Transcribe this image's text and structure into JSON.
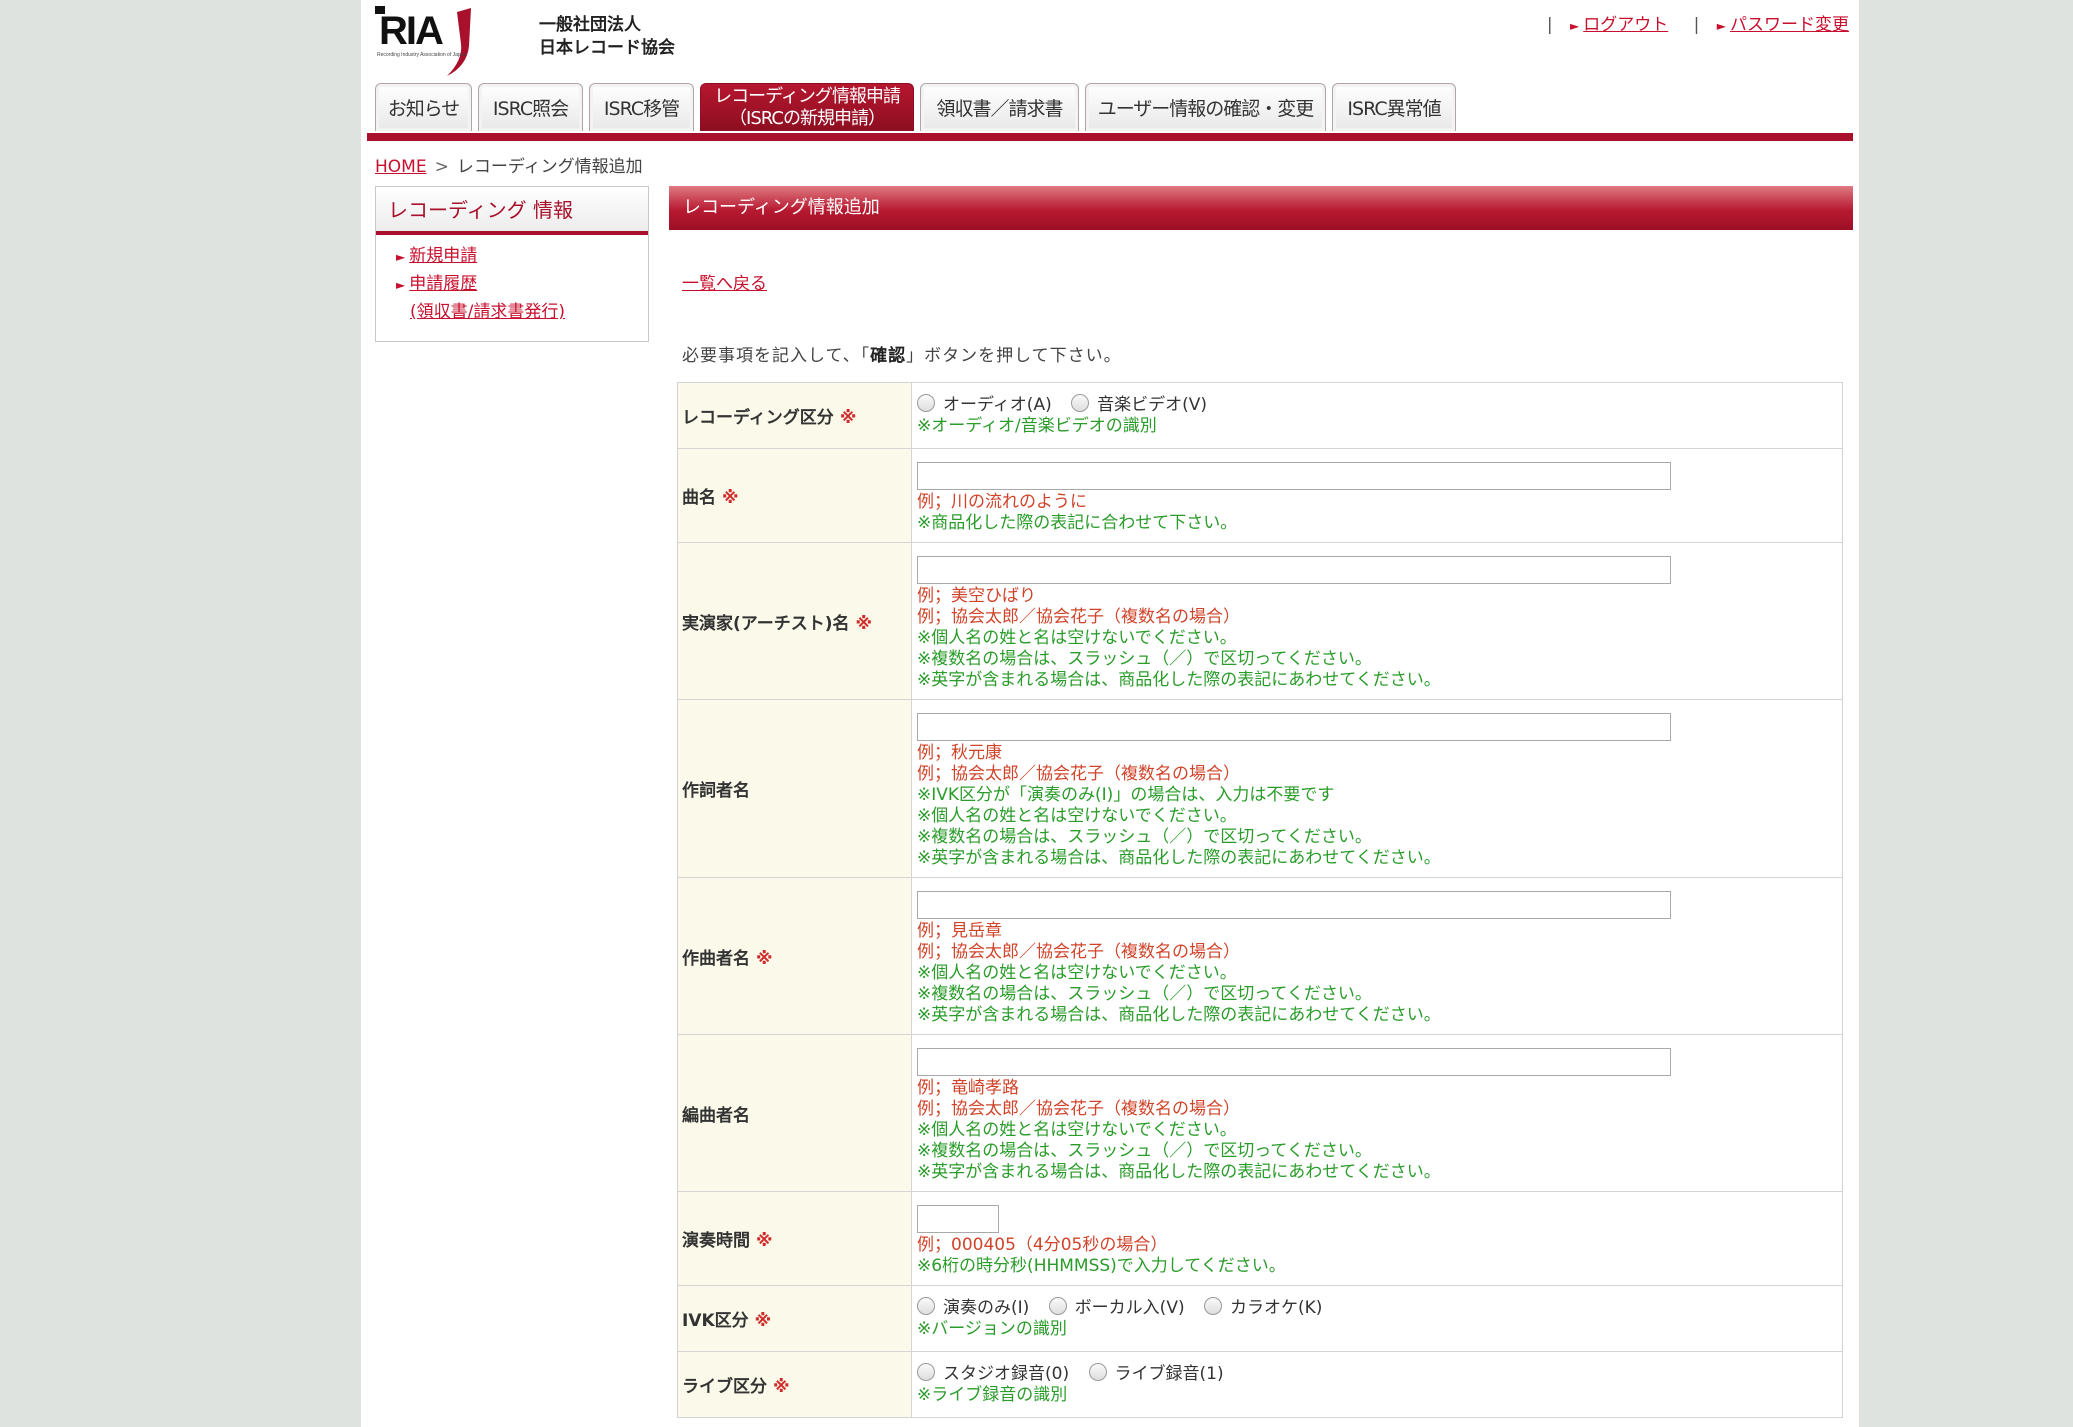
{
  "header": {
    "logo_text": "RIAJ",
    "logo_subtext": "Recording Industry Association of Japan",
    "org_line1": "一般社団法人",
    "org_line2": "日本レコード協会",
    "links": [
      {
        "label": "ログアウト"
      },
      {
        "label": "パスワード変更"
      }
    ]
  },
  "tabs": [
    {
      "label": "お知らせ"
    },
    {
      "label": "ISRC照会"
    },
    {
      "label": "ISRC移管"
    },
    {
      "label_line1": "レコーディング情報申請",
      "label_line2": "（ISRCの新規申請）"
    },
    {
      "label": "領収書／請求書"
    },
    {
      "label": "ユーザー情報の確認・変更"
    },
    {
      "label": "ISRC異常値"
    }
  ],
  "breadcrumb": {
    "home": "HOME",
    "separator": ">",
    "current": "レコーディング情報追加"
  },
  "sidebar": {
    "title": "レコーディング 情報",
    "items": [
      {
        "label": "新規申請"
      },
      {
        "label": "申請履歴",
        "sub": "(領収書/請求書発行)"
      }
    ]
  },
  "main": {
    "title": "レコーディング情報追加",
    "back_link": "一覧へ戻る",
    "instruction_prefix": "必要事項を記入して、「",
    "instruction_bold": "確認",
    "instruction_suffix": "」ボタンを押して下さい。"
  },
  "form": {
    "required_mark": "※",
    "recording_type": {
      "label": "レコーディング区分",
      "options": [
        "オーディオ(A)",
        "音楽ビデオ(V)"
      ],
      "note": "※オーディオ/音楽ビデオの識別"
    },
    "title": {
      "label": "曲名",
      "example": "例；川の流れのように",
      "note": "※商品化した際の表記に合わせて下さい。"
    },
    "artist": {
      "label": "実演家(アーチスト)名",
      "example1": "例；美空ひばり",
      "example2": "例；協会太郎／協会花子（複数名の場合）",
      "note1": "※個人名の姓と名は空けないでください。",
      "note2": "※複数名の場合は、スラッシュ（／）で区切ってください。",
      "note3": "※英字が含まれる場合は、商品化した際の表記にあわせてください。"
    },
    "lyricist": {
      "label": "作詞者名",
      "example1": "例；秋元康",
      "example2": "例；協会太郎／協会花子（複数名の場合）",
      "note0": "※IVK区分が「演奏のみ(I)」の場合は、入力は不要です",
      "note1": "※個人名の姓と名は空けないでください。",
      "note2": "※複数名の場合は、スラッシュ（／）で区切ってください。",
      "note3": "※英字が含まれる場合は、商品化した際の表記にあわせてください。"
    },
    "composer": {
      "label": "作曲者名",
      "example1": "例；見岳章",
      "example2": "例；協会太郎／協会花子（複数名の場合）",
      "note1": "※個人名の姓と名は空けないでください。",
      "note2": "※複数名の場合は、スラッシュ（／）で区切ってください。",
      "note3": "※英字が含まれる場合は、商品化した際の表記にあわせてください。"
    },
    "arranger": {
      "label": "編曲者名",
      "example1": "例；竜崎孝路",
      "example2": "例；協会太郎／協会花子（複数名の場合）",
      "note1": "※個人名の姓と名は空けないでください。",
      "note2": "※複数名の場合は、スラッシュ（／）で区切ってください。",
      "note3": "※英字が含まれる場合は、商品化した際の表記にあわせてください。"
    },
    "duration": {
      "label": "演奏時間",
      "example": "例；000405（4分05秒の場合）",
      "note": "※6桁の時分秒(HHMMSS)で入力してください。"
    },
    "ivk": {
      "label": "IVK区分",
      "options": [
        "演奏のみ(I)",
        "ボーカル入(V)",
        "カラオケ(K)"
      ],
      "note": "※バージョンの識別"
    },
    "live": {
      "label": "ライブ区分",
      "options": [
        "スタジオ録音(0)",
        "ライブ録音(1)"
      ],
      "note": "※ライブ録音の識別"
    }
  }
}
